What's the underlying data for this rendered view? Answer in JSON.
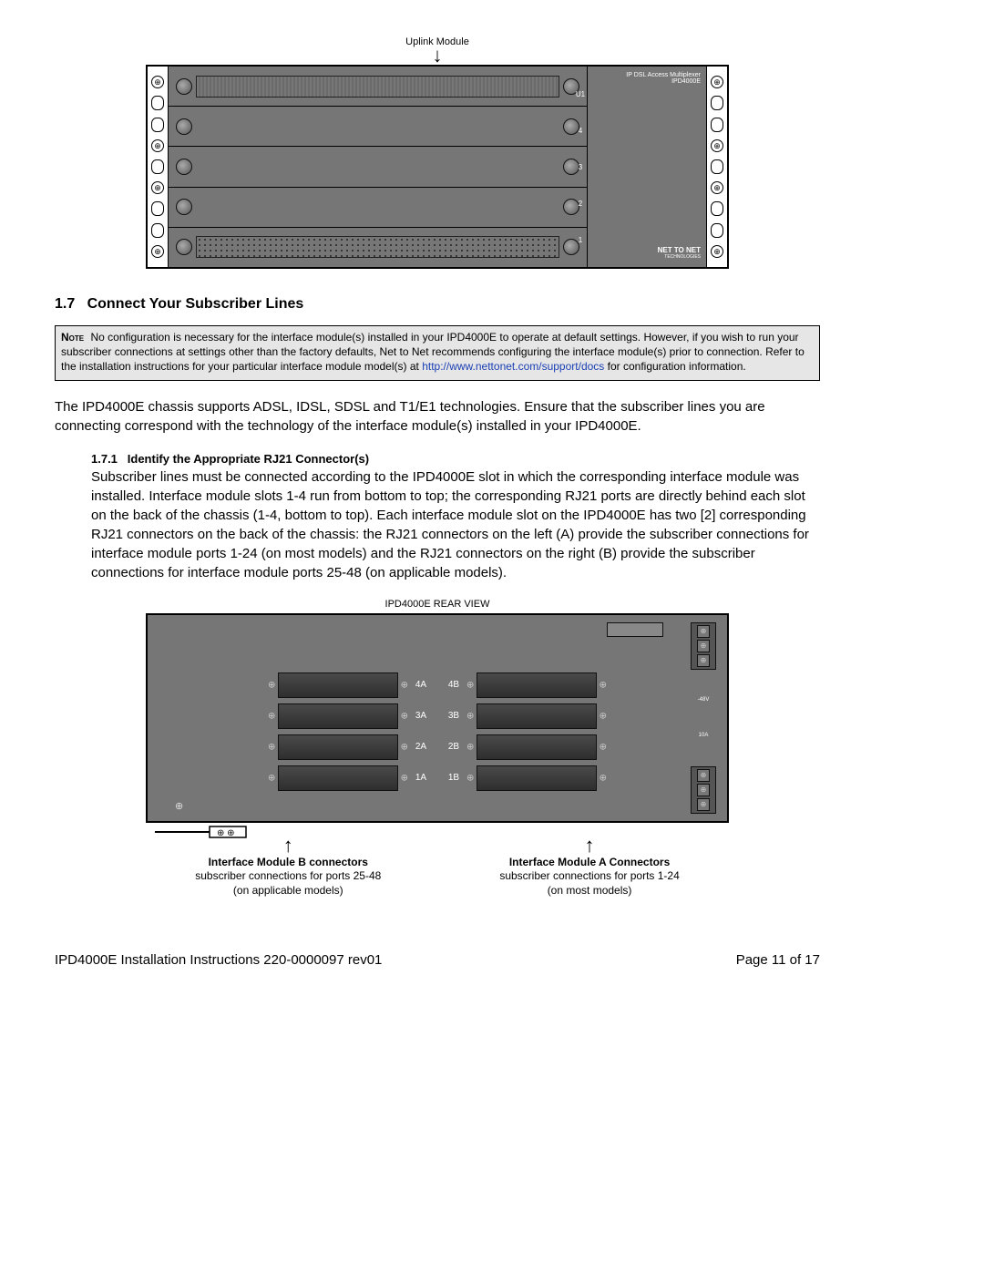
{
  "figure_top": {
    "uplink_label": "Uplink Module",
    "slot_numbers": [
      "U1",
      "4",
      "3",
      "2",
      "1"
    ],
    "right_text_1": "IP DSL Access Multiplexer",
    "right_text_2": "IPD4000E",
    "bottom_logo_top": "NET TO NET",
    "bottom_logo_sub": "TECHNOLOGIES"
  },
  "section": {
    "number": "1.7",
    "title": "Connect Your Subscriber Lines"
  },
  "note": {
    "label": "Note",
    "text_before_link": "No configuration is necessary for the interface module(s) installed in your IPD4000E to operate at default settings. However, if you wish to run your subscriber connections at settings other than the factory defaults, Net to Net recommends configuring the interface module(s) prior to connection. Refer to the installation instructions for your particular interface module model(s) at ",
    "link_text": "http://www.nettonet.com/support/docs",
    "text_after_link": " for configuration information."
  },
  "body_paragraph": "The IPD4000E chassis supports ADSL, IDSL, SDSL and T1/E1 technologies. Ensure that the subscriber lines you are connecting correspond with the technology of the interface module(s) installed in your IPD4000E.",
  "subsection": {
    "number": "1.7.1",
    "title": "Identify the Appropriate RJ21 Connector(s)",
    "body": "Subscriber lines must be connected according to the IPD4000E slot in which the corresponding interface module was installed. Interface module slots 1-4 run from bottom to top; the corresponding RJ21 ports are directly behind each slot on the back of the chassis (1-4, bottom to top). Each interface module slot on the IPD4000E has two [2] corresponding RJ21 connectors on the back of the chassis: the RJ21 connectors on the left (A) provide the subscriber connections for interface module ports 1-24 (on most models) and the RJ21 connectors on the right (B) provide the subscriber connections for interface module ports 25-48 (on applicable models)."
  },
  "figure_bottom": {
    "title": "IPD4000E REAR VIEW",
    "rows": [
      {
        "a": "4A",
        "b": "4B"
      },
      {
        "a": "3A",
        "b": "3B"
      },
      {
        "a": "2A",
        "b": "2B"
      },
      {
        "a": "1A",
        "b": "1B"
      }
    ],
    "power_label_v": "-48V",
    "power_label_a": "10A",
    "callout_b_title": "Interface Module B connectors",
    "callout_b_line1": "subscriber connections for ports 25-48",
    "callout_b_line2": "(on applicable models)",
    "callout_a_title": "Interface Module A Connectors",
    "callout_a_line1": "subscriber connections for ports 1-24",
    "callout_a_line2": "(on most models)"
  },
  "footer": {
    "left": "IPD4000E Installation Instructions 220-0000097 rev01",
    "right": "Page 11 of 17"
  }
}
